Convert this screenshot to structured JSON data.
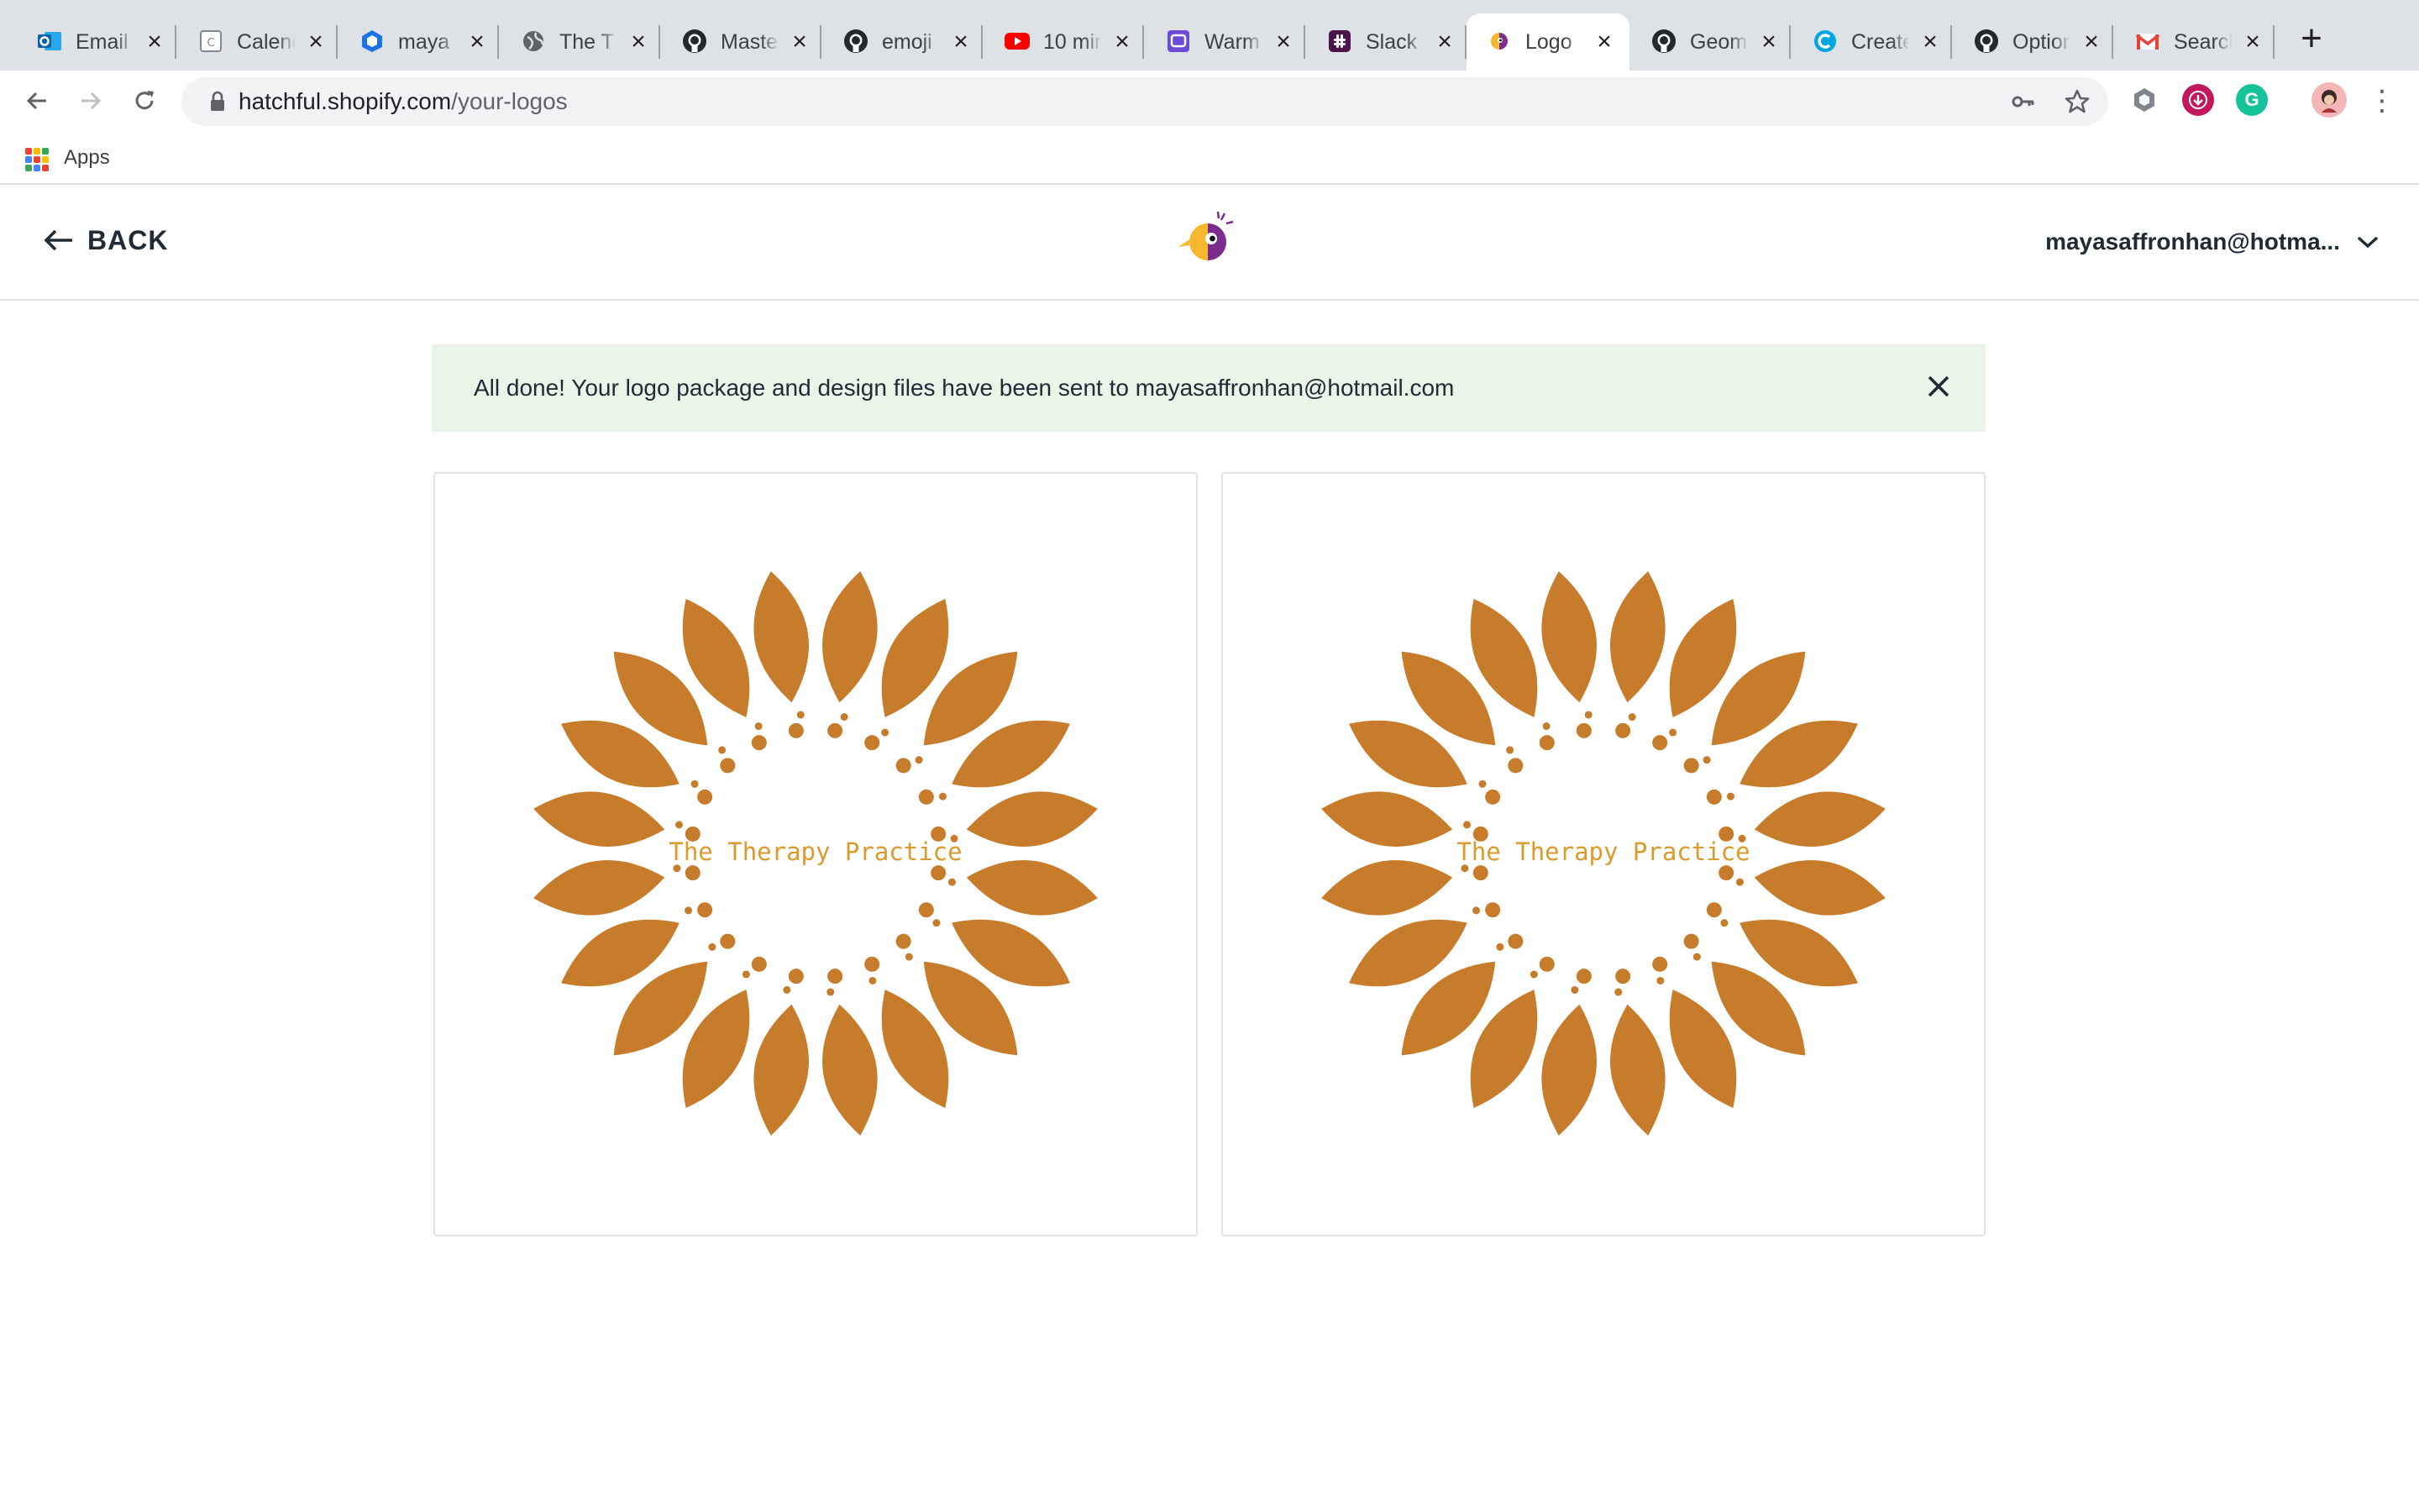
{
  "browser": {
    "tabs": [
      {
        "title": "Email",
        "icon": "outlook-icon",
        "active": false
      },
      {
        "title": "Calendar",
        "icon": "calendar-icon",
        "active": false
      },
      {
        "title": "maya",
        "icon": "cube-icon",
        "active": false
      },
      {
        "title": "The T",
        "icon": "globe-icon",
        "active": false
      },
      {
        "title": "Master",
        "icon": "github-icon",
        "active": false
      },
      {
        "title": "emoji",
        "icon": "github-icon",
        "active": false
      },
      {
        "title": "10 min",
        "icon": "youtube-icon",
        "active": false
      },
      {
        "title": "Warm",
        "icon": "warm-icon",
        "active": false
      },
      {
        "title": "Slack",
        "icon": "slack-icon",
        "active": false
      },
      {
        "title": "Logo",
        "icon": "hatchful-icon",
        "active": true
      },
      {
        "title": "Geom",
        "icon": "github-icon",
        "active": false
      },
      {
        "title": "Create",
        "icon": "canva-icon",
        "active": false
      },
      {
        "title": "Option",
        "icon": "github-icon",
        "active": false
      },
      {
        "title": "Search",
        "icon": "gmail-icon",
        "active": false
      }
    ],
    "url_host": "hatchful.shopify.com",
    "url_path": "/your-logos",
    "bookmarks": {
      "apps_label": "Apps"
    }
  },
  "header": {
    "back_label": "BACK",
    "account_email": "mayasaffronhan@hotma..."
  },
  "banner": {
    "message": "All done! Your logo package and design files have been sent to mayasaffronhan@hotmail.com"
  },
  "logos": [
    {
      "text": "The Therapy Practice",
      "petal_color": "#c67c2b",
      "text_color": "#dd9a2c"
    },
    {
      "text": "The Therapy Practice",
      "petal_color": "#c67c2b",
      "text_color": "#dd9a2c"
    }
  ],
  "colors": {
    "banner_bg": "#eaf5ea",
    "tabstrip_bg": "#dee1e6",
    "brand_yellow": "#f5b82e",
    "brand_purple": "#7b2d8e"
  }
}
